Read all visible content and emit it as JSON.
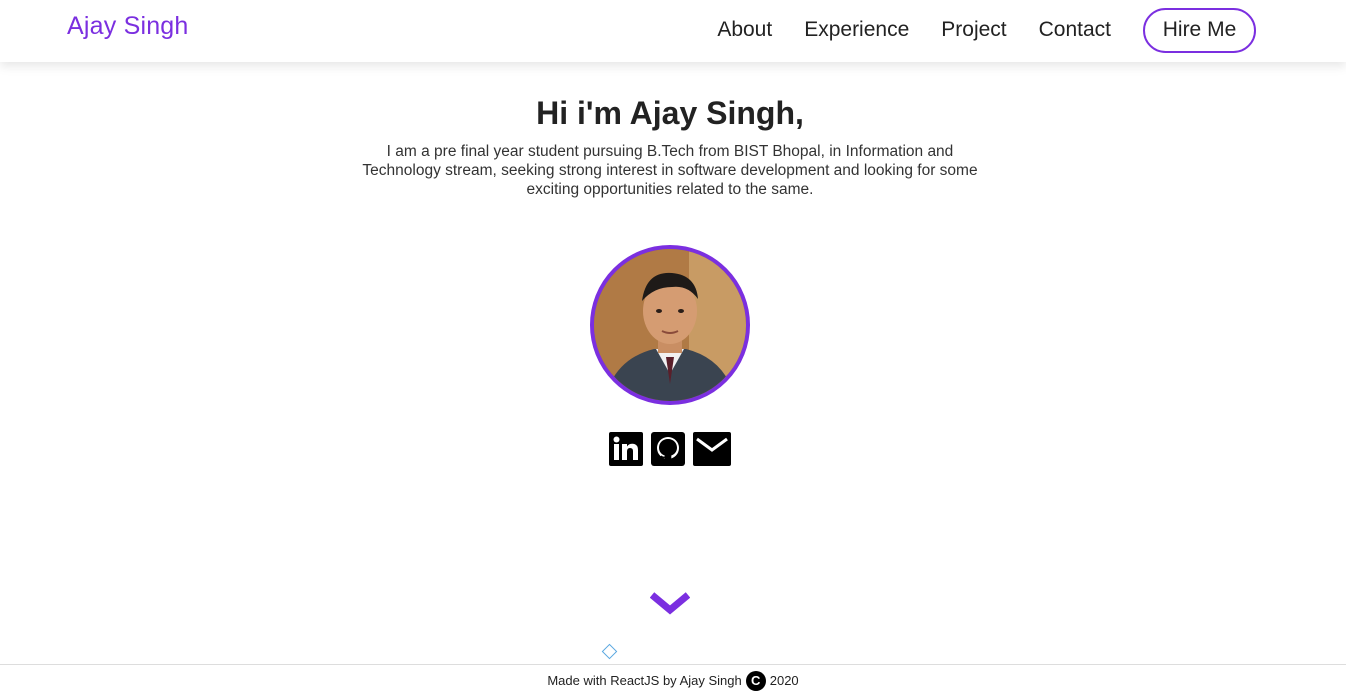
{
  "nav": {
    "brand": "Ajay Singh",
    "links": [
      "About",
      "Experience",
      "Project",
      "Contact"
    ],
    "cta": "Hire Me"
  },
  "hero": {
    "title": "Hi i'm Ajay Singh,",
    "description": "I am a pre final year student pursuing B.Tech from BIST Bhopal, in Information and Technology stream, seeking strong interest in software development and looking for some exciting opportunities related to the same."
  },
  "social": {
    "icons": [
      "linkedin-icon",
      "github-icon",
      "mail-icon"
    ]
  },
  "footer": {
    "prefix": "Made with ReactJS by Ajay Singh",
    "copyright_symbol": "C",
    "year": "2020"
  },
  "colors": {
    "accent": "#7b2fe0",
    "text": "#222222"
  }
}
